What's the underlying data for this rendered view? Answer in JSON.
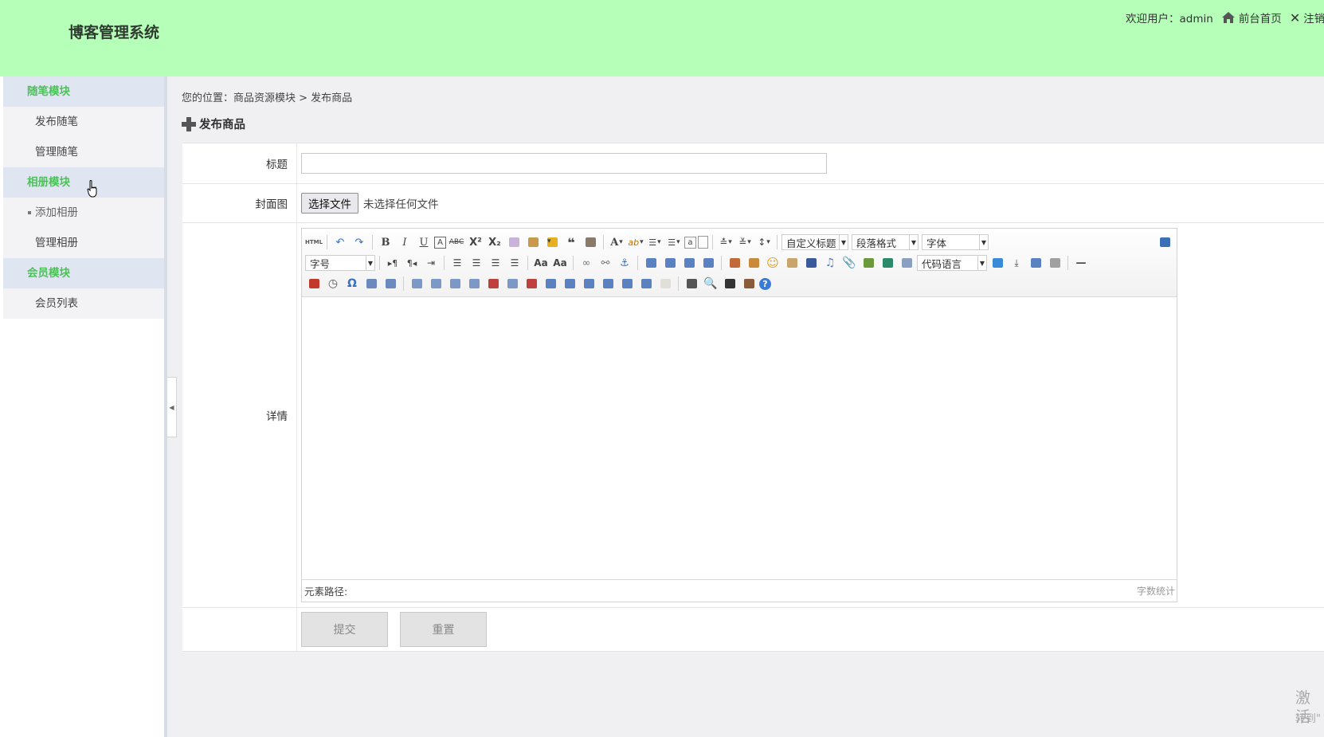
{
  "header": {
    "site_title": "博客管理系统",
    "welcome": "欢迎用户：admin",
    "home_link": "前台首页",
    "logout_link": "注销",
    "background_color": "#b6ffb9"
  },
  "sidebar": {
    "groups": [
      {
        "label": "随笔模块",
        "items": [
          {
            "label": "发布随笔"
          },
          {
            "label": "管理随笔"
          }
        ]
      },
      {
        "label": "相册模块",
        "items": [
          {
            "label": "添加相册",
            "active": true
          },
          {
            "label": "管理相册"
          }
        ]
      },
      {
        "label": "会员模块",
        "items": [
          {
            "label": "会员列表"
          }
        ]
      }
    ],
    "accent_color": "#4cc159"
  },
  "breadcrumb": "您的位置：商品资源模块 > 发布商品",
  "section_title": "发布商品",
  "form": {
    "title_label": "标题",
    "title_value": "",
    "cover_label": "封面图",
    "file_button": "选择文件",
    "file_status": "未选择任何文件",
    "detail_label": "详情",
    "submit": "提交",
    "reset": "重置"
  },
  "editor": {
    "html_button": "HTML",
    "custom_heading": "自定义标题",
    "paragraph_format": "段落格式",
    "font_family": "字体",
    "font_size": "字号",
    "code_language": "代码语言",
    "element_path": "元素路径:",
    "word_count": "字数统计"
  },
  "watermark": {
    "line1": "激活",
    "line2": "转到\""
  }
}
